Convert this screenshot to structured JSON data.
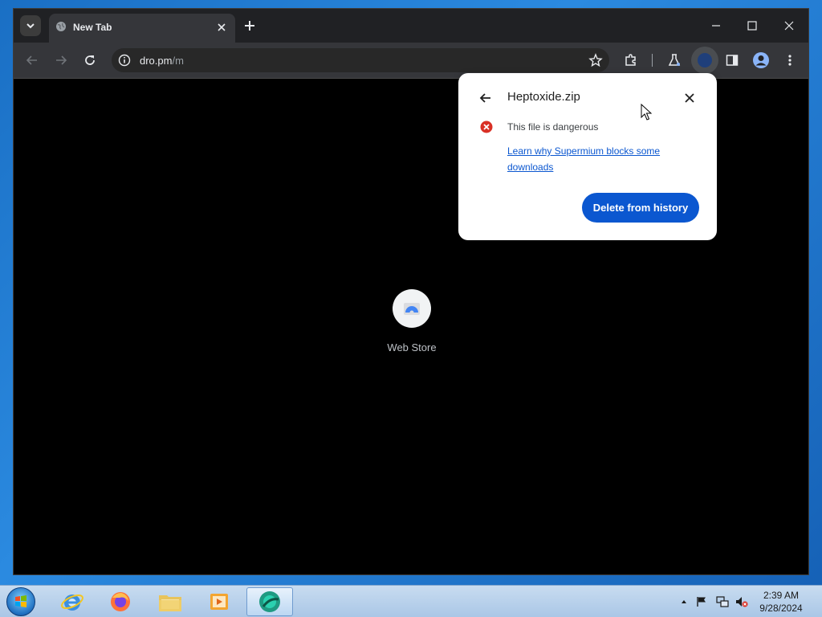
{
  "browser": {
    "tab": {
      "title": "New Tab"
    },
    "omnibox": {
      "host": "dro.pm",
      "path": "/m"
    }
  },
  "page": {
    "shortcut": {
      "label": "Web Store"
    }
  },
  "download_bubble": {
    "filename": "Heptoxide.zip",
    "status": "This file is dangerous",
    "learn_link": "Learn why Supermium blocks some downloads",
    "action_button": "Delete from history"
  },
  "taskbar": {
    "apps": [
      "internet-explorer",
      "firefox",
      "file-explorer",
      "media-player",
      "supermium"
    ],
    "clock": {
      "time": "2:39 AM",
      "date": "9/28/2024"
    }
  },
  "colors": {
    "accent": "#0b57d0",
    "error": "#d93025",
    "page_bg": "#000000",
    "chrome_bg": "#202124"
  }
}
